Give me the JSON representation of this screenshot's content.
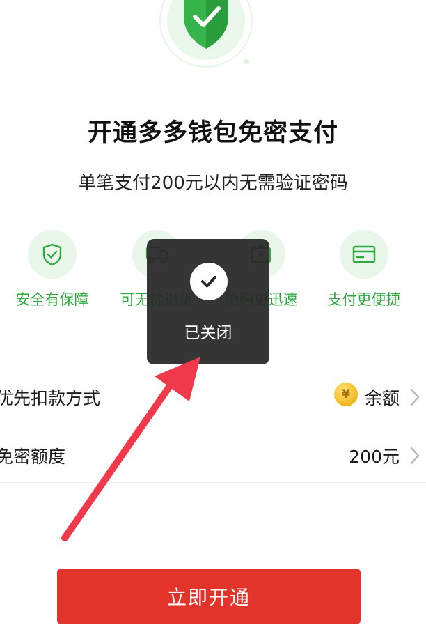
{
  "header": {
    "title": "开通多多钱包免密支付",
    "subtitle": "单笔支付200元以内无需验证密码"
  },
  "features": [
    {
      "icon": "shield-check-icon",
      "label": "安全有保障"
    },
    {
      "icon": "truck-icon",
      "label": "可无忧退货"
    },
    {
      "icon": "battery-bolt-icon",
      "label": "抢购更迅速"
    },
    {
      "icon": "card-icon",
      "label": "支付更便捷"
    }
  ],
  "rows": {
    "payment_method": {
      "label": "优先扣款方式",
      "value": "余额",
      "icon": "yen-coin-icon"
    },
    "limit": {
      "label": "免密额度",
      "value": "200元"
    }
  },
  "cta": {
    "label": "立即开通"
  },
  "toast": {
    "text": "已关闭",
    "icon": "check-icon"
  },
  "colors": {
    "accent_green": "#2fa840",
    "accent_red": "#e2342a",
    "toast_bg": "#282828",
    "arrow": "#f03a4c"
  }
}
